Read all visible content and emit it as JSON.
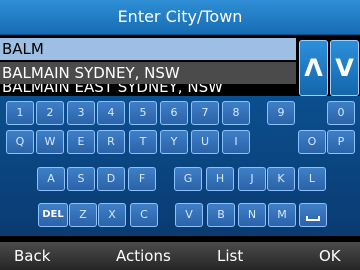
{
  "header": {
    "title": "Enter City/Town"
  },
  "search": {
    "input_value": "BALM"
  },
  "results": [
    {
      "label": "BALMAIN SYDNEY, NSW"
    },
    {
      "label": "BALMAIN EAST SYDNEY, NSW"
    }
  ],
  "nav": {
    "up_label": "Λ",
    "down_label": "V"
  },
  "keyboard": {
    "row1": [
      "1",
      "2",
      "3",
      "4",
      "5",
      "6",
      "7",
      "8",
      "9",
      "0"
    ],
    "row2": [
      "Q",
      "W",
      "E",
      "R",
      "T",
      "Y",
      "U",
      "I",
      "O",
      "P"
    ],
    "row3": [
      "A",
      "S",
      "D",
      "F",
      "G",
      "H",
      "J",
      "K",
      "L"
    ],
    "row4": [
      "DEL",
      "Z",
      "X",
      "C",
      "V",
      "B",
      "N",
      "M"
    ],
    "space_icon": "space-bar-icon"
  },
  "bottom": {
    "back": "Back",
    "actions": "Actions",
    "list": "List",
    "ok": "OK"
  }
}
